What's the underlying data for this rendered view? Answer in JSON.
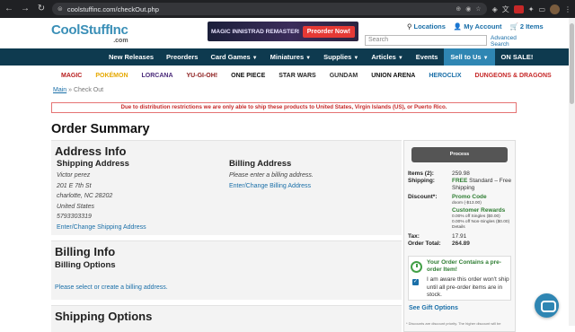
{
  "browser": {
    "url": "coolstuffinc.com/checkOut.php",
    "nav": [
      "←",
      "→",
      "↻"
    ]
  },
  "header": {
    "logo": "CoolStuffInc",
    "logo_sub": ".com",
    "banner_text": "MAGIC  INNISTRAD REMASTERED",
    "banner_cta": "Preorder Now!",
    "locations": "Locations",
    "my_account": "My Account",
    "cart": "2 Items",
    "search_placeholder": "Search",
    "advanced_search": "Advanced Search"
  },
  "nav": [
    {
      "label": "New Releases"
    },
    {
      "label": "Preorders"
    },
    {
      "label": "Card Games"
    },
    {
      "label": "Miniatures"
    },
    {
      "label": "Supplies"
    },
    {
      "label": "Articles"
    },
    {
      "label": "Events"
    },
    {
      "label": "Sell to Us"
    },
    {
      "label": "ON SALE!"
    }
  ],
  "brands": [
    {
      "label": "MAGIC",
      "color": "#b71c1c"
    },
    {
      "label": "POKÉMON",
      "color": "#e6a800"
    },
    {
      "label": "LORCANA",
      "color": "#4a2a7a"
    },
    {
      "label": "YU-GI-OH!",
      "color": "#8b1a1a"
    },
    {
      "label": "ONE PIECE",
      "color": "#111111"
    },
    {
      "label": "STAR WARS",
      "color": "#222222"
    },
    {
      "label": "GUNDAM",
      "color": "#333333"
    },
    {
      "label": "UNION ARENA",
      "color": "#111111"
    },
    {
      "label": "HEROCLIX",
      "color": "#1a6fa8"
    },
    {
      "label": "DUNGEONS & DRAGONS",
      "color": "#c62828"
    }
  ],
  "breadcrumb": {
    "home": "Main",
    "sep": " » ",
    "current": "Check Out"
  },
  "warning": "Due to distribution restrictions we are only able to ship these products to United States, Virgin Islands (US), or Puerto Rico.",
  "page_title": "Order Summary",
  "address_info": {
    "title": "Address Info",
    "shipping_heading": "Shipping Address",
    "shipping_lines": [
      "Victor perez",
      "201 E 7th St",
      "charlotte, NC 28202",
      "United States",
      "5793303319"
    ],
    "shipping_link": "Enter/Change Shipping Address",
    "billing_heading": "Billing Address",
    "billing_note": "Please enter a billing address.",
    "billing_link": "Enter/Change Billing Address"
  },
  "billing_info": {
    "title": "Billing Info",
    "options_heading": "Billing Options",
    "link": "Please select or create a billing address."
  },
  "shipping_options": {
    "title": "Shipping Options"
  },
  "summary": {
    "process_label": "Process",
    "items_label": "Items (2):",
    "items_value": "259.98",
    "shipping_label": "Shipping:",
    "shipping_free": "FREE",
    "shipping_value": "Standard – Free Shipping",
    "discount_label": "Discount*:",
    "promo_label": "Promo Code",
    "promo_line": "doom (-$13.00)",
    "rewards_label": "Customer Rewards",
    "rewards_line1": "0.00% off Singles ($0.00)",
    "rewards_line2": "0.00% off Non-Singles ($0.00)",
    "rewards_details": "Details",
    "tax_label": "Tax:",
    "tax_value": "17.91",
    "total_label": "Order Total:",
    "total_value": "264.89",
    "preorder_title": "Your Order Contains a pre-order Item!",
    "preorder_text": "I am aware this order won't ship until all pre-order items are in stock.",
    "gift_options": "See Gift Options",
    "fine_print": "* Discounts are discount priority. The higher discount will be"
  }
}
